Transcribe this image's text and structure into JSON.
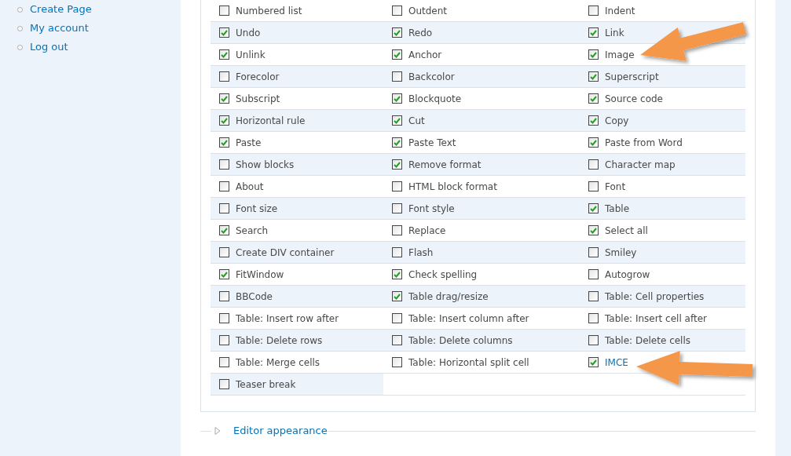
{
  "sidebar": {
    "items": [
      {
        "label": "Create Page"
      },
      {
        "label": "My account"
      },
      {
        "label": "Log out"
      }
    ]
  },
  "table": {
    "rows": [
      {
        "cells": [
          {
            "label": "Numbered list",
            "checked": false
          },
          {
            "label": "Outdent",
            "checked": false
          },
          {
            "label": "Indent",
            "checked": false
          }
        ]
      },
      {
        "cells": [
          {
            "label": "Undo",
            "checked": true
          },
          {
            "label": "Redo",
            "checked": true
          },
          {
            "label": "Link",
            "checked": true
          }
        ]
      },
      {
        "cells": [
          {
            "label": "Unlink",
            "checked": true
          },
          {
            "label": "Anchor",
            "checked": true
          },
          {
            "label": "Image",
            "checked": true
          }
        ]
      },
      {
        "cells": [
          {
            "label": "Forecolor",
            "checked": false
          },
          {
            "label": "Backcolor",
            "checked": false
          },
          {
            "label": "Superscript",
            "checked": true
          }
        ]
      },
      {
        "cells": [
          {
            "label": "Subscript",
            "checked": true
          },
          {
            "label": "Blockquote",
            "checked": true
          },
          {
            "label": "Source code",
            "checked": true
          }
        ]
      },
      {
        "cells": [
          {
            "label": "Horizontal rule",
            "checked": true
          },
          {
            "label": "Cut",
            "checked": true
          },
          {
            "label": "Copy",
            "checked": true
          }
        ]
      },
      {
        "cells": [
          {
            "label": "Paste",
            "checked": true
          },
          {
            "label": "Paste Text",
            "checked": true
          },
          {
            "label": "Paste from Word",
            "checked": true
          }
        ]
      },
      {
        "cells": [
          {
            "label": "Show blocks",
            "checked": false
          },
          {
            "label": "Remove format",
            "checked": true
          },
          {
            "label": "Character map",
            "checked": false
          }
        ]
      },
      {
        "cells": [
          {
            "label": "About",
            "checked": false
          },
          {
            "label": "HTML block format",
            "checked": false
          },
          {
            "label": "Font",
            "checked": false
          }
        ]
      },
      {
        "cells": [
          {
            "label": "Font size",
            "checked": false
          },
          {
            "label": "Font style",
            "checked": false
          },
          {
            "label": "Table",
            "checked": true
          }
        ]
      },
      {
        "cells": [
          {
            "label": "Search",
            "checked": true
          },
          {
            "label": "Replace",
            "checked": false
          },
          {
            "label": "Select all",
            "checked": true
          }
        ]
      },
      {
        "cells": [
          {
            "label": "Create DIV container",
            "checked": false
          },
          {
            "label": "Flash",
            "checked": false
          },
          {
            "label": "Smiley",
            "checked": false
          }
        ]
      },
      {
        "cells": [
          {
            "label": "FitWindow",
            "checked": true
          },
          {
            "label": "Check spelling",
            "checked": true
          },
          {
            "label": "Autogrow",
            "checked": false
          }
        ]
      },
      {
        "cells": [
          {
            "label": "BBCode",
            "checked": false
          },
          {
            "label": "Table drag/resize",
            "checked": true
          },
          {
            "label": "Table: Cell properties",
            "checked": false
          }
        ]
      },
      {
        "cells": [
          {
            "label": "Table: Insert row after",
            "checked": false
          },
          {
            "label": "Table: Insert column after",
            "checked": false
          },
          {
            "label": "Table: Insert cell after",
            "checked": false
          }
        ]
      },
      {
        "cells": [
          {
            "label": "Table: Delete rows",
            "checked": false
          },
          {
            "label": "Table: Delete columns",
            "checked": false
          },
          {
            "label": "Table: Delete cells",
            "checked": false
          }
        ]
      },
      {
        "cells": [
          {
            "label": "Table: Merge cells",
            "checked": false
          },
          {
            "label": "Table: Horizontal split cell",
            "checked": false
          },
          {
            "label": "IMCE",
            "checked": true,
            "link": true
          }
        ]
      },
      {
        "cells": [
          {
            "label": "Teaser break",
            "checked": false
          }
        ]
      }
    ]
  },
  "collapsible_section": {
    "title": "Editor appearance",
    "expanded": false
  }
}
